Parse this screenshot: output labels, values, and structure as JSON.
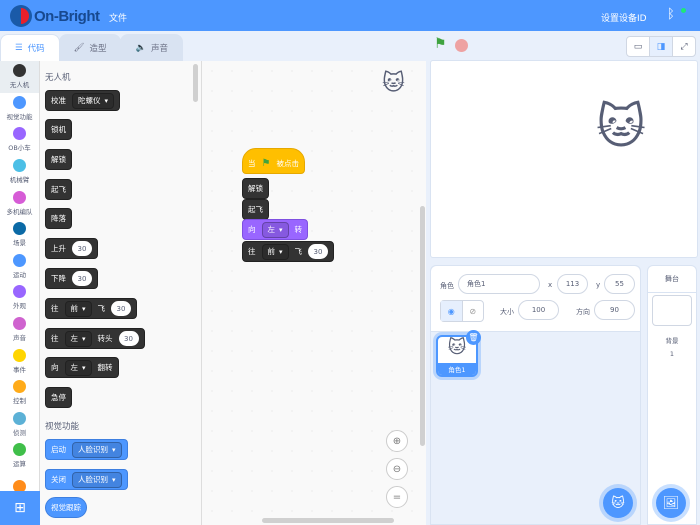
{
  "header": {
    "logo_text": "On-Bright",
    "file_menu": "文件",
    "set_device_id": "设置设备ID",
    "bluetooth_icon": "bluetooth-icon"
  },
  "tabs": [
    {
      "label": "代码",
      "icon": "code-icon"
    },
    {
      "label": "造型",
      "icon": "brush-icon"
    },
    {
      "label": "声音",
      "icon": "speaker-icon"
    }
  ],
  "categories": [
    {
      "label": "无人机",
      "color": "#333333"
    },
    {
      "label": "视觉功能",
      "color": "#4d97ff"
    },
    {
      "label": "OB小车",
      "color": "#9966ff"
    },
    {
      "label": "机械臂",
      "color": "#4cbfe6"
    },
    {
      "label": "多机编队",
      "color": "#d65cd6"
    },
    {
      "label": "场景",
      "color": "#0b6aa6"
    },
    {
      "label": "运动",
      "color": "#4d97ff"
    },
    {
      "label": "外观",
      "color": "#9966ff"
    },
    {
      "label": "声音",
      "color": "#cf63cf"
    },
    {
      "label": "事件",
      "color": "#ffd500"
    },
    {
      "label": "控制",
      "color": "#ffab19"
    },
    {
      "label": "侦测",
      "color": "#5cb1d6"
    },
    {
      "label": "运算",
      "color": "#40bf4a"
    },
    {
      "label": "",
      "color": "#ff8c1a"
    }
  ],
  "palette": {
    "heading_drone": "无人机",
    "heading_vision": "视觉功能",
    "blocks": [
      {
        "type": "drone",
        "parts": [
          {
            "t": "校准"
          },
          {
            "d": "陀螺仪"
          }
        ]
      },
      {
        "type": "drone",
        "parts": [
          {
            "t": "锁机"
          }
        ]
      },
      {
        "type": "drone",
        "parts": [
          {
            "t": "解锁"
          }
        ]
      },
      {
        "type": "drone",
        "parts": [
          {
            "t": "起飞"
          }
        ]
      },
      {
        "type": "drone",
        "parts": [
          {
            "t": "降落"
          }
        ]
      },
      {
        "type": "drone",
        "parts": [
          {
            "t": "上升"
          },
          {
            "n": "30"
          }
        ]
      },
      {
        "type": "drone",
        "parts": [
          {
            "t": "下降"
          },
          {
            "n": "30"
          }
        ]
      },
      {
        "type": "drone",
        "parts": [
          {
            "t": "往"
          },
          {
            "d": "前"
          },
          {
            "t": "飞"
          },
          {
            "n": "30"
          }
        ]
      },
      {
        "type": "drone",
        "parts": [
          {
            "t": "往"
          },
          {
            "d": "左"
          },
          {
            "t": "转头"
          },
          {
            "n": "30"
          }
        ]
      },
      {
        "type": "drone",
        "parts": [
          {
            "t": "向"
          },
          {
            "d": "左"
          },
          {
            "t": "翻转"
          }
        ]
      },
      {
        "type": "drone",
        "parts": [
          {
            "t": "急停"
          }
        ]
      },
      {
        "type": "vision",
        "parts": [
          {
            "t": "启动"
          },
          {
            "d": "人脸识别"
          }
        ]
      },
      {
        "type": "vision",
        "parts": [
          {
            "t": "关闭"
          },
          {
            "d": "人脸识别"
          }
        ]
      },
      {
        "type": "vision pill",
        "parts": [
          {
            "t": "视觉跟踪"
          }
        ]
      }
    ]
  },
  "script": [
    {
      "type": "event",
      "parts": [
        {
          "t": "当"
        },
        {
          "flag": "green-flag-icon"
        },
        {
          "t": "被点击"
        }
      ]
    },
    {
      "type": "drone",
      "parts": [
        {
          "t": "解锁"
        }
      ]
    },
    {
      "type": "drone",
      "parts": [
        {
          "t": "起飞"
        }
      ]
    },
    {
      "type": "motion",
      "parts": [
        {
          "t": "向"
        },
        {
          "d": "左"
        },
        {
          "t": "转"
        }
      ]
    },
    {
      "type": "drone",
      "parts": [
        {
          "t": "往"
        },
        {
          "d": "前"
        },
        {
          "t": "飞"
        },
        {
          "n": "30"
        }
      ]
    }
  ],
  "sprite": {
    "label_sprite": "角色",
    "name": "角色1",
    "label_x": "x",
    "x": "113",
    "label_y": "y",
    "y": "55",
    "label_size": "大小",
    "size": "100",
    "label_direction": "方向",
    "direction": "90",
    "show_visible": true,
    "thumb_name": "角色1"
  },
  "stage_pane": {
    "title": "舞台",
    "backdrops_label": "背景",
    "backdrops_count": "1"
  },
  "colors": {
    "header": "#4d97ff",
    "accent": "#4d97ff"
  }
}
